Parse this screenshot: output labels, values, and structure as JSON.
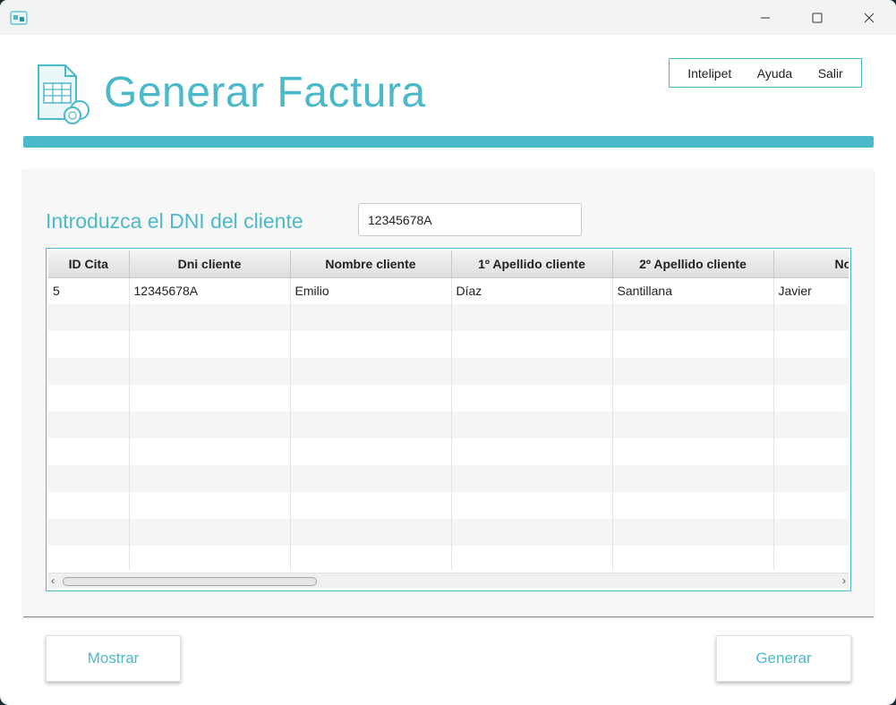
{
  "window": {
    "controls": {
      "minimize": "minimize-icon",
      "maximize": "maximize-icon",
      "close": "close-icon"
    }
  },
  "header": {
    "title": "Generar Factura",
    "menu": [
      "Intelipet",
      "Ayuda",
      "Salir"
    ]
  },
  "search": {
    "label": "Introduzca el DNI del cliente",
    "value": "12345678A"
  },
  "table": {
    "columns": [
      "ID Cita",
      "Dni cliente",
      "Nombre cliente",
      "1º Apellido cliente",
      "2º Apellido cliente",
      "Nombre"
    ],
    "rows": [
      [
        "5",
        "12345678A",
        "Emilio",
        "Díaz",
        "Santillana",
        "Javier"
      ]
    ],
    "empty_rows": 10
  },
  "buttons": {
    "show": "Mostrar",
    "generate": "Generar"
  },
  "colors": {
    "accent": "#4cb9c9",
    "titlebar": "#f3f3f3",
    "panel": "#f7f7f7"
  }
}
